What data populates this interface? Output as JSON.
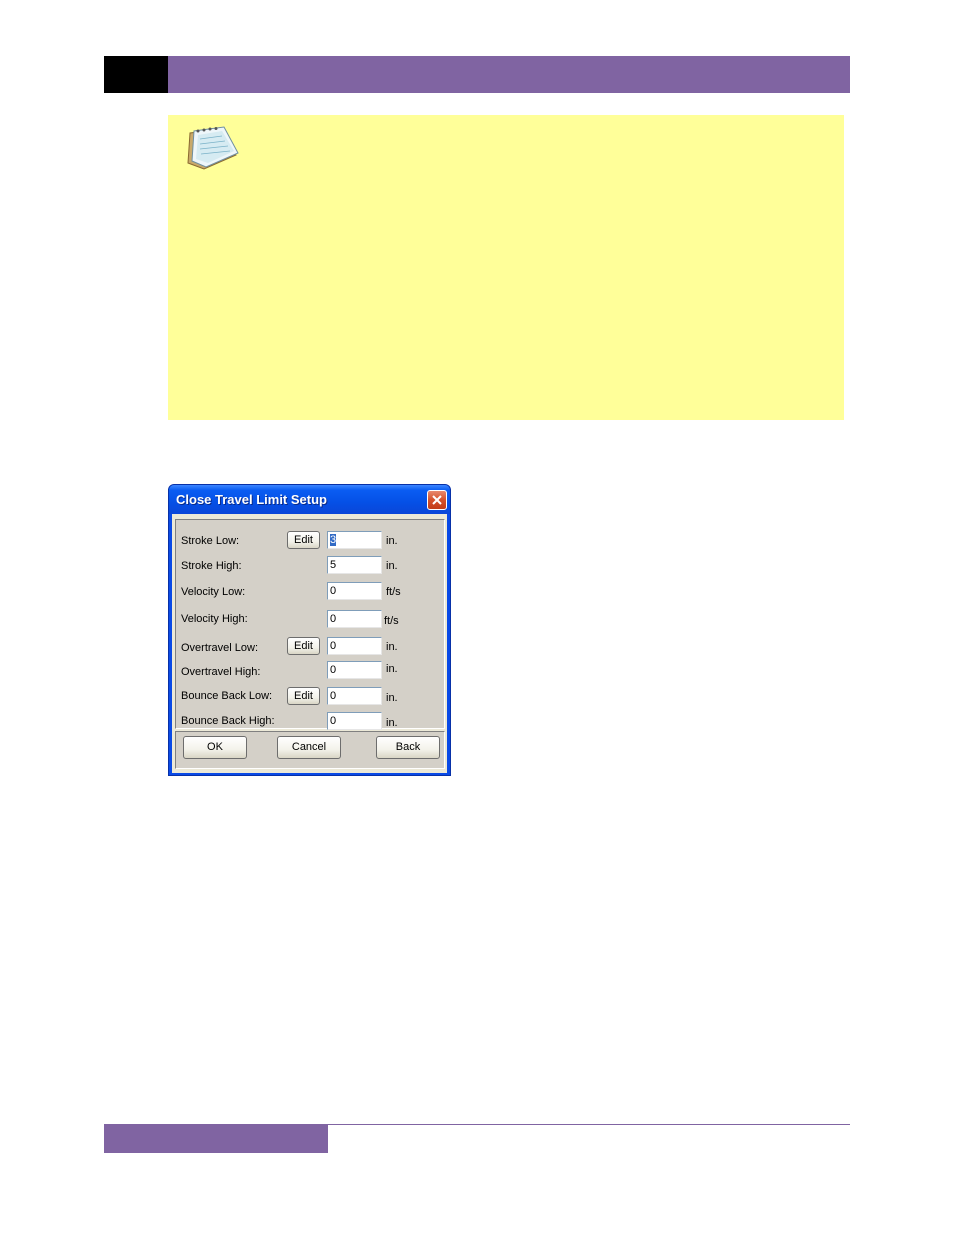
{
  "dialog": {
    "title": "Close Travel Limit Setup",
    "close_icon": "close-x-icon",
    "fields": [
      {
        "label": "Stroke Low:",
        "has_edit": true,
        "edit_label": "Edit",
        "value": "3",
        "unit": "in.",
        "value_selected": true
      },
      {
        "label": "Stroke High:",
        "has_edit": false,
        "value": "5",
        "unit": "in."
      },
      {
        "label": "Velocity Low:",
        "has_edit": false,
        "value": "0",
        "unit": "ft/s"
      },
      {
        "label": "Velocity High:",
        "has_edit": false,
        "value": "0",
        "unit": "ft/s"
      },
      {
        "label": "Overtravel Low:",
        "has_edit": true,
        "edit_label": "Edit",
        "value": "0",
        "unit": "in."
      },
      {
        "label": "Overtravel High:",
        "has_edit": false,
        "value": "0",
        "unit": "in."
      },
      {
        "label": "Bounce Back Low:",
        "has_edit": true,
        "edit_label": "Edit",
        "value": "0",
        "unit": "in."
      },
      {
        "label": "Bounce Back High:",
        "has_edit": false,
        "value": "0",
        "unit": "in."
      }
    ],
    "buttons": {
      "ok": "OK",
      "cancel": "Cancel",
      "back": "Back"
    }
  },
  "note": {
    "icon": "notepad-icon"
  },
  "colors": {
    "brand_purple": "#8064a2",
    "note_yellow": "#ffff99",
    "titlebar_blue": "#0550e6",
    "selection_blue": "#316ac5"
  }
}
